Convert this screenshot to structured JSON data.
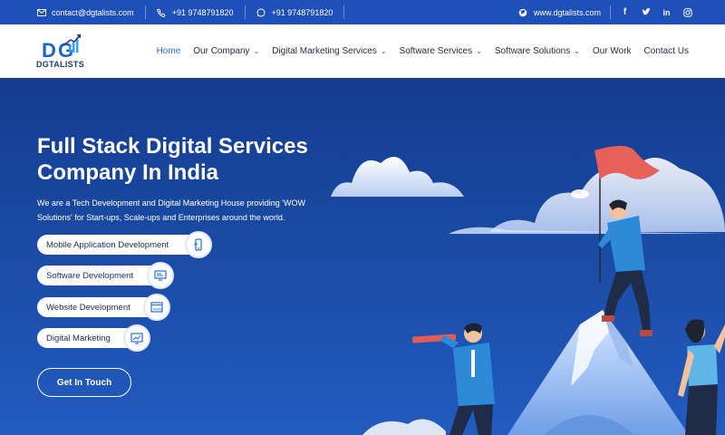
{
  "topbar": {
    "email": "contact@dgtalists.com",
    "phone": "+91 9748791820",
    "whatsapp": "+91 9748791820",
    "website": "www.dgtalists.com",
    "icons": [
      "mail-icon",
      "phone-icon",
      "whatsapp-icon",
      "globe-icon",
      "facebook-icon",
      "twitter-icon",
      "linkedin-icon",
      "instagram-icon"
    ]
  },
  "logo": {
    "text": "DGTALISTS"
  },
  "nav": {
    "items": [
      {
        "label": "Home",
        "active": true,
        "dropdown": false
      },
      {
        "label": "Our Company",
        "dropdown": true
      },
      {
        "label": "Digital Marketing Services",
        "dropdown": true
      },
      {
        "label": "Software Services",
        "dropdown": true
      },
      {
        "label": "Software Solutions",
        "dropdown": true
      },
      {
        "label": "Our Work",
        "dropdown": false
      },
      {
        "label": "Contact Us",
        "dropdown": false
      }
    ]
  },
  "hero": {
    "title": "Full Stack Digital Services Company In India",
    "lead": "We are a Tech Development and Digital Marketing House providing 'WOW Solutions' for Start-ups, Scale-ups and Enterprises around the world.",
    "services": [
      {
        "label": "Mobile Application Development",
        "icon": "mobile-app-icon"
      },
      {
        "label": "Software Development",
        "icon": "software-icon"
      },
      {
        "label": "Website Development",
        "icon": "website-icon"
      },
      {
        "label": "Digital Marketing",
        "icon": "marketing-icon"
      }
    ],
    "cta": "Get In Touch"
  },
  "colors": {
    "topbar": "#1f4fb8",
    "hero": "#1a4aa3",
    "accent": "#2a6fd6",
    "flag": "#e8605a"
  }
}
